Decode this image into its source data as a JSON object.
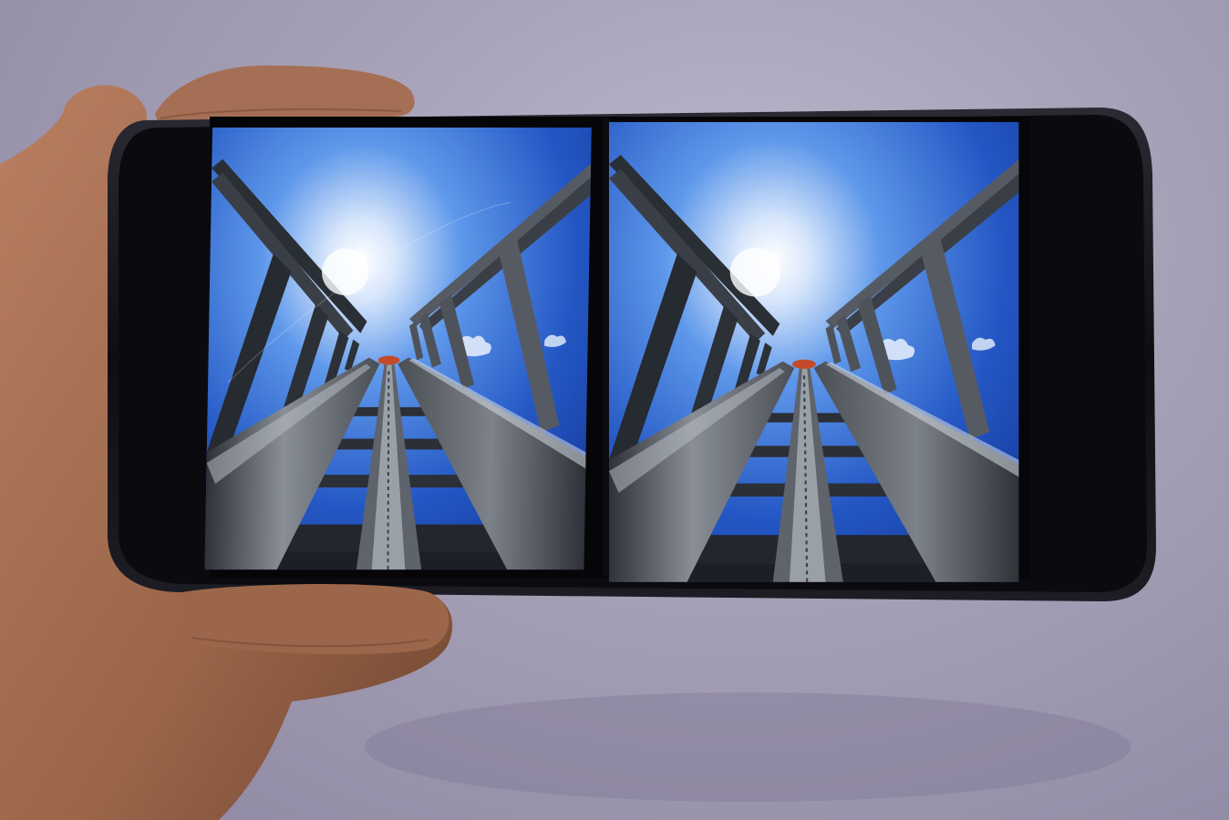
{
  "scene": {
    "subject": "smartphone-held-in-hand",
    "display_mode": "side-by-side-stereo-vr",
    "content": "roller-coaster-lift-hill-view",
    "colors": {
      "wall": "#a8a2b8",
      "skin": "#a56f55",
      "phone_body": "#141419",
      "sky_top": "#1f4fb8",
      "sky_mid": "#4d8fe6",
      "sun": "#ffffff",
      "rail": "#6c7078",
      "beam": "#3f444c",
      "car_accent": "#c44a2c"
    }
  }
}
